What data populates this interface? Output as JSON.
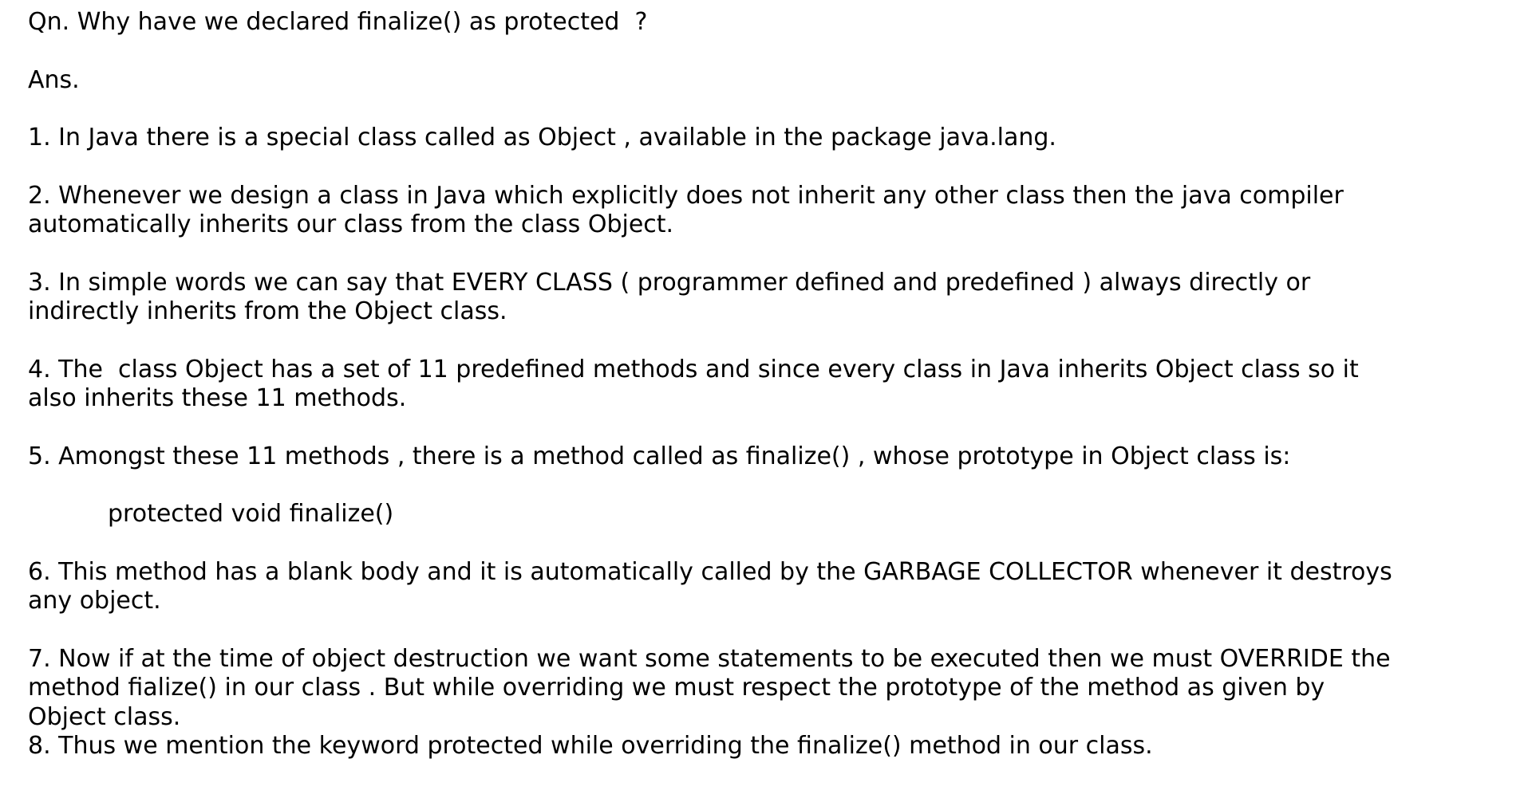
{
  "document": {
    "question": "Qn. Why have we declared finalize() as protected  ?",
    "answer_label": "Ans.",
    "points": [
      {
        "lines": [
          "1. In Java there is a special class called as Object , available in the package java.lang."
        ]
      },
      {
        "lines": [
          "2. Whenever we design a class in Java which explicitly does not inherit any other class then the java compiler",
          "automatically inherits our class from the class Object."
        ]
      },
      {
        "lines": [
          "3. In simple words we can say that EVERY CLASS ( programmer defined and predefined ) always directly or",
          "indirectly inherits from the Object class."
        ]
      },
      {
        "lines": [
          "4. The  class Object has a set of 11 predefined methods and since every class in Java inherits Object class so it",
          "also inherits these 11 methods."
        ]
      },
      {
        "lines": [
          "5. Amongst these 11 methods , there is a method called as finalize() , whose prototype in Object class is:"
        ]
      },
      {
        "lines": [
          "6. This method has a blank body and it is automatically called by the GARBAGE COLLECTOR whenever it destroys",
          "any object."
        ]
      },
      {
        "lines": [
          "7. Now if at the time of object destruction we want some statements to be executed then we must OVERRIDE the",
          "method fialize() in our class . But while overriding we must respect the prototype of the method as given by",
          "Object class."
        ]
      },
      {
        "lines": [
          "8. Thus we mention the keyword protected while overriding the finalize() method in our class."
        ]
      }
    ],
    "prototype_code": "protected void finalize()"
  }
}
